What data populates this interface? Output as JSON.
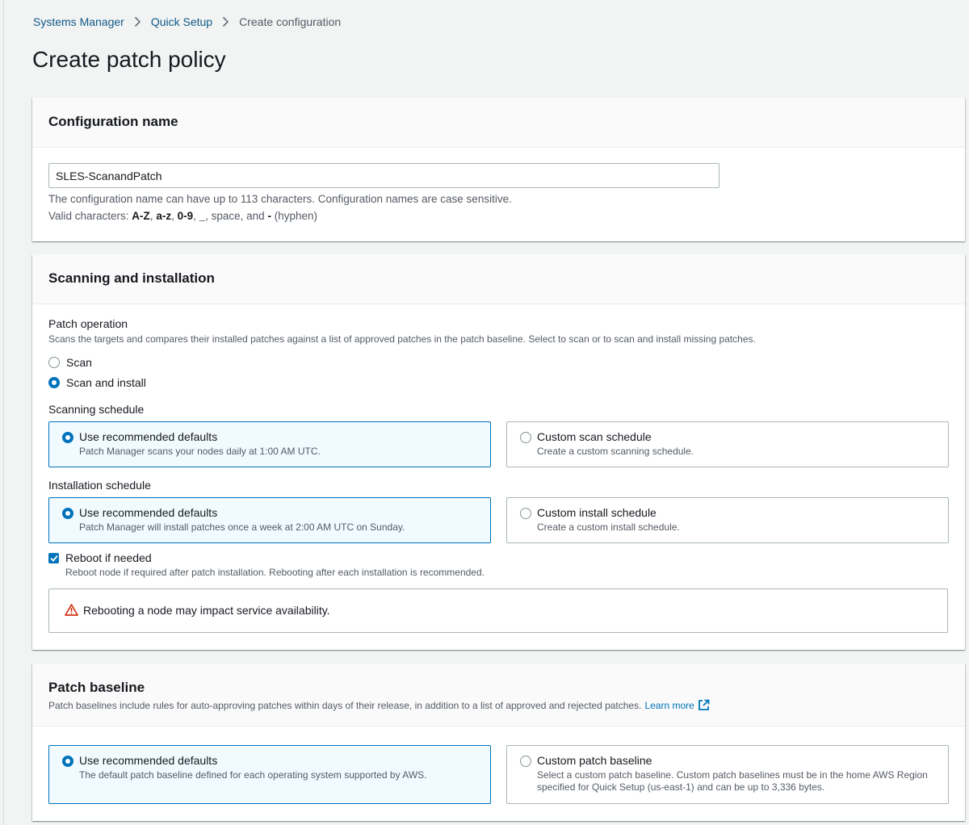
{
  "breadcrumb": {
    "items": [
      {
        "label": "Systems Manager"
      },
      {
        "label": "Quick Setup"
      },
      {
        "label": "Create configuration"
      }
    ]
  },
  "page": {
    "title": "Create patch policy"
  },
  "config_name": {
    "title": "Configuration name",
    "value": "SLES-ScanandPatch",
    "hint1": "The configuration name can have up to 113 characters. Configuration names are case sensitive.",
    "hint2_prefix": "Valid characters: ",
    "hint2_a": "A-Z",
    "hint2_b": "a-z",
    "hint2_c": "0-9",
    "hint2_d": "_",
    "hint2_mid": ", space, and ",
    "hint2_e": "-",
    "hint2_suffix": " (hyphen)",
    "comma": ", "
  },
  "scanning": {
    "title": "Scanning and installation",
    "patch_operation": {
      "label": "Patch operation",
      "description": "Scans the targets and compares their installed patches against a list of approved patches in the patch baseline. Select to scan or to scan and install missing patches.",
      "options": [
        {
          "label": "Scan",
          "selected": false
        },
        {
          "label": "Scan and install",
          "selected": true
        }
      ]
    },
    "scan_schedule": {
      "label": "Scanning schedule",
      "tiles": [
        {
          "label": "Use recommended defaults",
          "description": "Patch Manager scans your nodes daily at 1:00 AM UTC.",
          "selected": true
        },
        {
          "label": "Custom scan schedule",
          "description": "Create a custom scanning schedule.",
          "selected": false
        }
      ]
    },
    "install_schedule": {
      "label": "Installation schedule",
      "tiles": [
        {
          "label": "Use recommended defaults",
          "description": "Patch Manager will install patches once a week at 2:00 AM UTC on Sunday.",
          "selected": true
        },
        {
          "label": "Custom install schedule",
          "description": "Create a custom install schedule.",
          "selected": false
        }
      ]
    },
    "reboot": {
      "label": "Reboot if needed",
      "description": "Reboot node if required after patch installation. Rebooting after each installation is recommended.",
      "checked": true
    },
    "alert": {
      "text": "Rebooting a node may impact service availability.",
      "color": "#d13212"
    }
  },
  "baseline": {
    "title": "Patch baseline",
    "description": "Patch baselines include rules for auto-approving patches within days of their release, in addition to a list of approved and rejected patches.",
    "learn_more": "Learn more",
    "tiles": [
      {
        "label": "Use recommended defaults",
        "description": "The default patch baseline defined for each operating system supported by AWS.",
        "selected": true
      },
      {
        "label": "Custom patch baseline",
        "description": "Select a custom patch baseline. Custom patch baselines must be in the home AWS Region specified for Quick Setup (us-east-1) and can be up to 3,336 bytes.",
        "selected": false
      }
    ]
  },
  "colors": {
    "accent": "#0073bb",
    "link": "#0f5a8a",
    "warning": "#d13212"
  }
}
